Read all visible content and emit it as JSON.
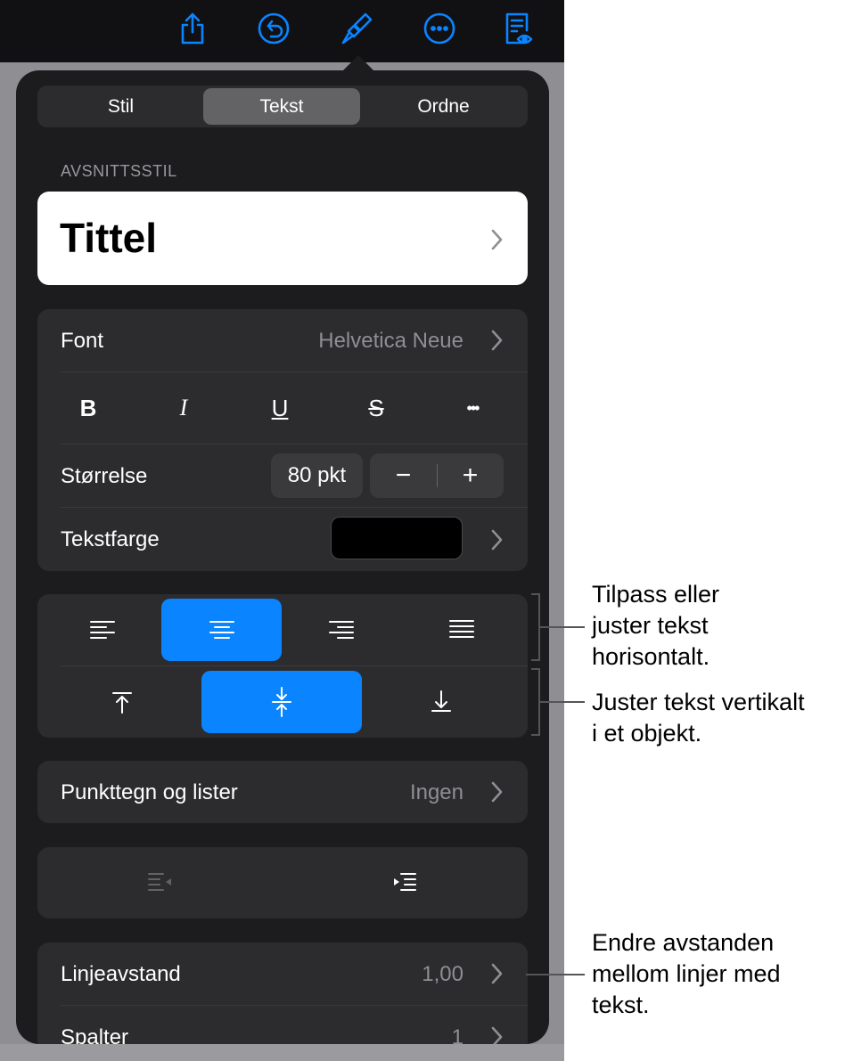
{
  "toolbar": {
    "icons": [
      "share-icon",
      "undo-icon",
      "format-brush-icon",
      "more-icon",
      "reading-view-icon"
    ],
    "accent": "#0a84ff"
  },
  "popover": {
    "tabs": [
      {
        "label": "Stil",
        "active": false
      },
      {
        "label": "Tekst",
        "active": true
      },
      {
        "label": "Ordne",
        "active": false
      }
    ],
    "paragraph_style_label": "AVSNITTSSTIL",
    "paragraph_style_value": "Tittel",
    "font": {
      "label": "Font",
      "value": "Helvetica Neue"
    },
    "format_buttons": {
      "bold": "B",
      "italic": "I",
      "underline": "U",
      "strike": "S",
      "more": "•••"
    },
    "size": {
      "label": "Størrelse",
      "value": "80 pkt",
      "minus": "−",
      "plus": "+"
    },
    "text_color": {
      "label": "Tekstfarge",
      "color": "#000000"
    },
    "horizontal_align": {
      "options": [
        "left",
        "center",
        "right",
        "justify"
      ],
      "selected": "center"
    },
    "vertical_align": {
      "options": [
        "top",
        "middle",
        "bottom"
      ],
      "selected": "middle"
    },
    "bullets": {
      "label": "Punkttegn og lister",
      "value": "Ingen"
    },
    "line_spacing": {
      "label": "Linjeavstand",
      "value": "1,00"
    },
    "columns": {
      "label": "Spalter",
      "value": "1"
    }
  },
  "callouts": {
    "horizontal": "Tilpass eller\njuster tekst\nhorisontalt.",
    "vertical": "Juster tekst vertikalt\ni et objekt.",
    "spacing": "Endre avstanden\nmellom linjer med\ntekst."
  }
}
